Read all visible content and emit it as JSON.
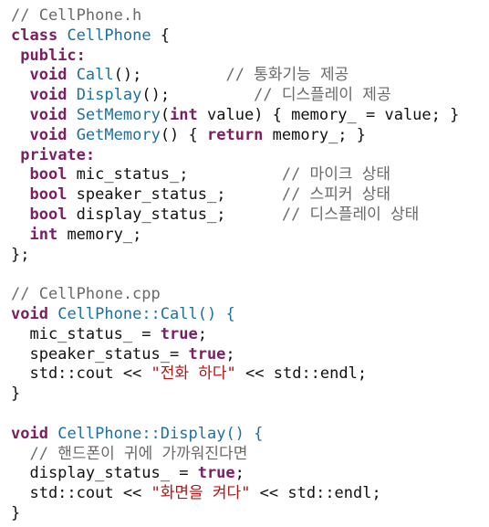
{
  "colors": {
    "keyword": "#7a1f63",
    "comment": "#6a6a6a",
    "function": "#1f6f9f",
    "string": "#b01717",
    "text": "#111111",
    "background": "#ffffff"
  },
  "code_lines": [
    [
      {
        "t": "// CellPhone.h",
        "k": "cm"
      }
    ],
    [
      {
        "t": "class",
        "k": "kw"
      },
      {
        "t": " "
      },
      {
        "t": "CellPhone",
        "k": "fn"
      },
      {
        "t": " {"
      }
    ],
    [
      {
        "t": " "
      },
      {
        "t": "public:",
        "k": "kw"
      }
    ],
    [
      {
        "t": "  "
      },
      {
        "t": "void",
        "k": "kw"
      },
      {
        "t": " "
      },
      {
        "t": "Call",
        "k": "fn"
      },
      {
        "t": "();         "
      },
      {
        "t": "// 통화기능 제공",
        "k": "cm"
      }
    ],
    [
      {
        "t": "  "
      },
      {
        "t": "void",
        "k": "kw"
      },
      {
        "t": " "
      },
      {
        "t": "Display",
        "k": "fn"
      },
      {
        "t": "();         "
      },
      {
        "t": "// 디스플레이 제공",
        "k": "cm"
      }
    ],
    [
      {
        "t": "  "
      },
      {
        "t": "void",
        "k": "kw"
      },
      {
        "t": " "
      },
      {
        "t": "SetMemory",
        "k": "fn"
      },
      {
        "t": "("
      },
      {
        "t": "int",
        "k": "kw"
      },
      {
        "t": " value) { memory_ = value; }"
      }
    ],
    [
      {
        "t": "  "
      },
      {
        "t": "void",
        "k": "kw"
      },
      {
        "t": " "
      },
      {
        "t": "GetMemory",
        "k": "fn"
      },
      {
        "t": "() { "
      },
      {
        "t": "return",
        "k": "kw"
      },
      {
        "t": " memory_; }"
      }
    ],
    [
      {
        "t": " "
      },
      {
        "t": "private:",
        "k": "kw"
      }
    ],
    [
      {
        "t": "  "
      },
      {
        "t": "bool",
        "k": "kw"
      },
      {
        "t": " mic_status_;          "
      },
      {
        "t": "// 마이크 상태",
        "k": "cm"
      }
    ],
    [
      {
        "t": "  "
      },
      {
        "t": "bool",
        "k": "kw"
      },
      {
        "t": " speaker_status_;      "
      },
      {
        "t": "// 스피커 상태",
        "k": "cm"
      }
    ],
    [
      {
        "t": "  "
      },
      {
        "t": "bool",
        "k": "kw"
      },
      {
        "t": " display_status_;      "
      },
      {
        "t": "// 디스플레이 상태",
        "k": "cm"
      }
    ],
    [
      {
        "t": "  "
      },
      {
        "t": "int",
        "k": "kw"
      },
      {
        "t": " memory_;"
      }
    ],
    [
      {
        "t": "};"
      }
    ],
    [
      {
        "t": ""
      }
    ],
    [
      {
        "t": "// CellPhone.cpp",
        "k": "cm"
      }
    ],
    [
      {
        "t": "void",
        "k": "kw"
      },
      {
        "t": " "
      },
      {
        "t": "CellPhone::Call",
        "k": "fn"
      },
      {
        "t": "() {",
        "k": "fn"
      }
    ],
    [
      {
        "t": "  mic_status_ = "
      },
      {
        "t": "true",
        "k": "kw"
      },
      {
        "t": ";"
      }
    ],
    [
      {
        "t": "  speaker_status_= "
      },
      {
        "t": "true",
        "k": "kw"
      },
      {
        "t": ";"
      }
    ],
    [
      {
        "t": "  std::cout << "
      },
      {
        "t": "\"전화 하다\"",
        "k": "str"
      },
      {
        "t": " << std::endl;"
      }
    ],
    [
      {
        "t": "}"
      }
    ],
    [
      {
        "t": ""
      }
    ],
    [
      {
        "t": "void",
        "k": "kw"
      },
      {
        "t": " "
      },
      {
        "t": "CellPhone::Display",
        "k": "fn"
      },
      {
        "t": "() {",
        "k": "fn"
      }
    ],
    [
      {
        "t": "  "
      },
      {
        "t": "// 핸드폰이 귀에 가까워진다면",
        "k": "cm"
      }
    ],
    [
      {
        "t": "  display_status_ = "
      },
      {
        "t": "true",
        "k": "kw"
      },
      {
        "t": ";"
      }
    ],
    [
      {
        "t": "  std::cout << "
      },
      {
        "t": "\"화면을 켜다\"",
        "k": "str"
      },
      {
        "t": " << std::endl;"
      }
    ],
    [
      {
        "t": "}"
      }
    ]
  ]
}
